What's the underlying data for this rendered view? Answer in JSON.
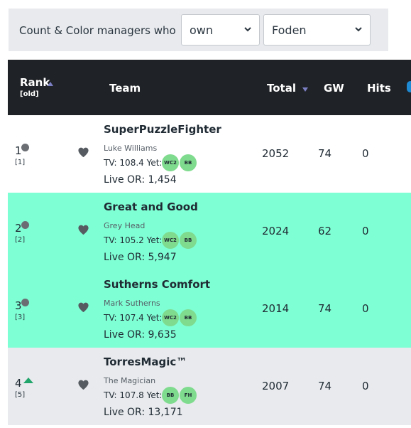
{
  "filter": {
    "label": "Count & Color managers who",
    "mode_value": "own",
    "player_value": "Foden"
  },
  "table": {
    "headers": {
      "rank": "Rank",
      "rank_sub": "[old]",
      "team": "Team",
      "total": "Total",
      "gw": "GW",
      "hits": "Hits"
    },
    "rows": [
      {
        "rank": "1",
        "prev_rank": "[1]",
        "movement": "same",
        "team": "SuperPuzzleFighter",
        "manager": "Luke Williams",
        "tv": "TV: 108.4 Yet:",
        "chips": [
          "WC2",
          "BB"
        ],
        "live_or": "Live OR: 1,454",
        "total": "2052",
        "gw": "74",
        "hits": "0",
        "highlight": false
      },
      {
        "rank": "2",
        "prev_rank": "[2]",
        "movement": "same",
        "team": "Great and Good",
        "manager": "Grey Head",
        "tv": "TV: 105.2 Yet:",
        "chips": [
          "WC2",
          "BB"
        ],
        "live_or": "Live OR: 5,947",
        "total": "2024",
        "gw": "62",
        "hits": "0",
        "highlight": true
      },
      {
        "rank": "3",
        "prev_rank": "[3]",
        "movement": "same",
        "team": "Sutherns Comfort",
        "manager": "Mark Sutherns",
        "tv": "TV: 107.4 Yet:",
        "chips": [
          "WC2",
          "BB"
        ],
        "live_or": "Live OR: 9,635",
        "total": "2014",
        "gw": "74",
        "hits": "0",
        "highlight": true
      },
      {
        "rank": "4",
        "prev_rank": "[5]",
        "movement": "up",
        "team": "TorresMagic™",
        "manager": "The Magician",
        "tv": "TV: 107.8 Yet:",
        "chips": [
          "BB",
          "FH"
        ],
        "live_or": "Live OR: 13,171",
        "total": "2007",
        "gw": "74",
        "hits": "0",
        "highlight": false
      }
    ]
  },
  "colors": {
    "header_bg": "#1f2226",
    "highlight_row": "#7fffd4",
    "shaded_row": "#e8eaed",
    "plain_row": "#ffffff",
    "chip_bg": "#7fdb8e",
    "move_up": "#22a56b",
    "move_same": "#6b6f74",
    "sort_arrow": "#7b7fc4"
  },
  "icons": {
    "favorite": "heart-icon",
    "dropdown": "chevron-down-icon",
    "sort_asc": "sort-up-icon",
    "sort_desc": "sort-down-icon",
    "movement_same": "dot-icon",
    "movement_up": "arrow-up-icon"
  }
}
